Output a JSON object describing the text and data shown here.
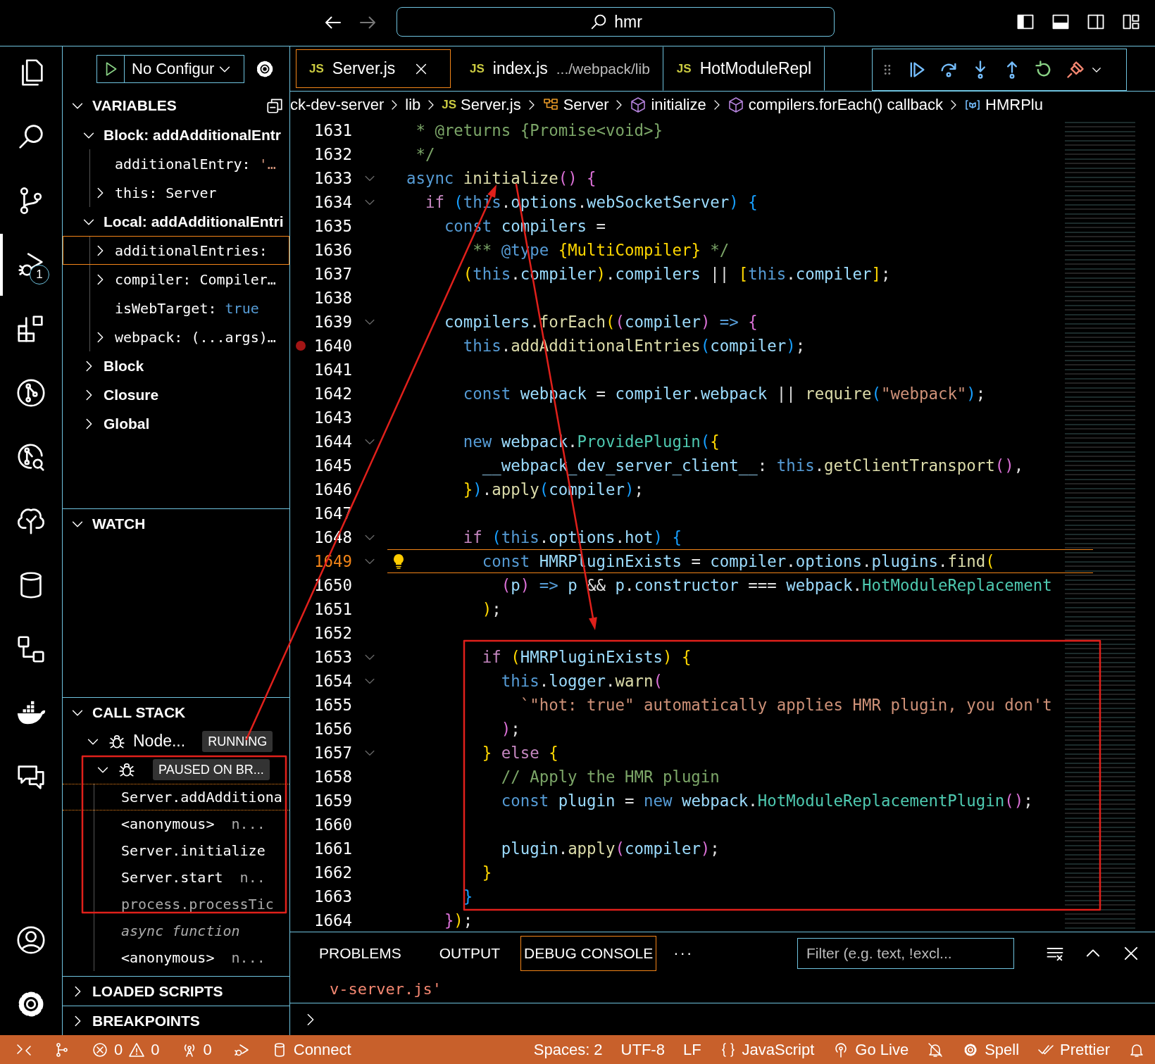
{
  "title_bar": {
    "command_center": {
      "text": "hmr"
    }
  },
  "activity_bar": {
    "items": [
      {
        "kind": "files",
        "selected": false
      },
      {
        "kind": "search",
        "selected": false
      },
      {
        "kind": "source-control",
        "selected": false
      },
      {
        "kind": "run-debug",
        "selected": true,
        "badge": "1"
      },
      {
        "kind": "extensions",
        "selected": false
      },
      {
        "kind": "git-graph",
        "selected": false
      },
      {
        "kind": "git-search",
        "selected": false
      },
      {
        "kind": "tree-check",
        "selected": false
      },
      {
        "kind": "database",
        "selected": false
      },
      {
        "kind": "diagram",
        "selected": false
      },
      {
        "kind": "docker",
        "selected": false
      },
      {
        "kind": "comments",
        "selected": false
      }
    ],
    "bottom_items": [
      {
        "kind": "account",
        "selected": false
      },
      {
        "kind": "settings",
        "selected": false
      }
    ]
  },
  "sidebar": {
    "run_config": "No Configur",
    "variables": {
      "title": "VARIABLES",
      "expanded": true,
      "scopes": [
        {
          "label": "Block: addAdditionalEntr",
          "expanded": true,
          "items": [
            {
              "name": "additionalEntry:",
              "value": "'…",
              "kind": "string",
              "expandable": false,
              "selected": false
            },
            {
              "name": "this:",
              "value": "Server",
              "kind": "object",
              "expandable": true,
              "selected": false
            }
          ]
        },
        {
          "label": "Local: addAdditionalEntri",
          "expanded": true,
          "items": [
            {
              "name": "additionalEntries:",
              "expandable": true,
              "selected": true
            },
            {
              "name": "compiler:",
              "value": "Compiler…",
              "kind": "object",
              "expandable": true,
              "selected": false
            },
            {
              "name": "isWebTarget:",
              "value": "true",
              "kind": "boolean",
              "expandable": false,
              "selected": false
            },
            {
              "name": "webpack:",
              "value": "(...args)…",
              "kind": "object",
              "expandable": true,
              "selected": false
            }
          ]
        },
        {
          "label": "Block",
          "expanded": false
        },
        {
          "label": "Closure",
          "expanded": false
        },
        {
          "label": "Global",
          "expanded": false
        }
      ]
    },
    "watch": {
      "title": "WATCH",
      "expanded": true
    },
    "call_stack": {
      "title": "CALL STACK",
      "expanded": true,
      "threads": [
        {
          "name": "Node...",
          "status": "RUNNING",
          "expanded": true
        },
        {
          "status": "PAUSED ON BR...",
          "expanded": true
        }
      ],
      "frames": [
        {
          "kind": "frame",
          "name": "Server.addAdditiona",
          "selected": true,
          "dimmed": false
        },
        {
          "kind": "frame",
          "name": "<anonymous>",
          "source": "n...",
          "selected": false,
          "dimmed": false
        },
        {
          "kind": "frame",
          "name": "Server.initialize",
          "selected": false,
          "dimmed": false
        },
        {
          "kind": "frame",
          "name": "Server.start",
          "source": "n..",
          "selected": false,
          "dimmed": false
        },
        {
          "kind": "frame",
          "name": "process.processTic",
          "selected": false,
          "dimmed": true
        },
        {
          "kind": "separator",
          "name": "async function",
          "selected": false,
          "dimmed": true
        },
        {
          "kind": "frame",
          "name": "<anonymous>",
          "source": "n...",
          "selected": false,
          "dimmed": false
        }
      ]
    },
    "loaded_scripts": {
      "title": "LOADED SCRIPTS",
      "expanded": false
    },
    "breakpoints": {
      "title": "BREAKPOINTS",
      "expanded": false
    }
  },
  "editor": {
    "tabs": [
      {
        "badge": "JS",
        "name": "Server.js",
        "selected": true
      },
      {
        "badge": "JS",
        "name": "index.js",
        "description": ".../webpack/lib",
        "selected": false
      },
      {
        "badge": "JS",
        "name": "HotModuleRepl",
        "selected": false
      }
    ],
    "breadcrumbs": [
      {
        "kind": "folder",
        "text": "ck-dev-server"
      },
      {
        "kind": "folder",
        "text": "lib"
      },
      {
        "kind": "file",
        "badge": "JS",
        "text": "Server.js"
      },
      {
        "kind": "class",
        "text": "Server"
      },
      {
        "kind": "method",
        "text": "initialize"
      },
      {
        "kind": "method",
        "text": "compilers.forEach() callback"
      },
      {
        "kind": "variable",
        "text": "HMRPlu"
      }
    ],
    "code_lines": [
      {
        "number": "1631",
        "breakpoint": false,
        "foldable": false,
        "current": false,
        "tokens": [
          {
            "text": "   * @returns {Promise<void>}",
            "kind": "comment"
          }
        ]
      },
      {
        "number": "1632",
        "breakpoint": false,
        "foldable": false,
        "current": false,
        "tokens": [
          {
            "text": "   */",
            "kind": "comment"
          }
        ]
      },
      {
        "number": "1633",
        "breakpoint": false,
        "foldable": true,
        "current": false,
        "tokens": [
          {
            "text": "  async ",
            "kind": "keyword"
          },
          {
            "text": "initialize",
            "kind": "function"
          },
          {
            "text": "() ",
            "kind": "bracket2"
          },
          {
            "text": "{",
            "kind": "bracket2"
          }
        ]
      },
      {
        "number": "1634",
        "breakpoint": false,
        "foldable": true,
        "current": false,
        "tokens": [
          {
            "text": "    if ",
            "kind": "control"
          },
          {
            "text": "(",
            "kind": "bracket3"
          },
          {
            "text": "this",
            "kind": "keyword"
          },
          {
            "text": ".",
            "kind": "punct"
          },
          {
            "text": "options",
            "kind": "variable"
          },
          {
            "text": ".",
            "kind": "punct"
          },
          {
            "text": "webSocketServer",
            "kind": "variable"
          },
          {
            "text": ") ",
            "kind": "bracket3"
          },
          {
            "text": "{",
            "kind": "bracket3"
          }
        ]
      },
      {
        "number": "1635",
        "breakpoint": false,
        "foldable": false,
        "current": false,
        "tokens": [
          {
            "text": "      const ",
            "kind": "keyword"
          },
          {
            "text": "compilers",
            "kind": "variable"
          },
          {
            "text": " =",
            "kind": "punct"
          }
        ]
      },
      {
        "number": "1636",
        "breakpoint": false,
        "foldable": false,
        "current": false,
        "tokens": [
          {
            "text": "         ** ",
            "kind": "comment"
          },
          {
            "text": "@type ",
            "kind": "keyword"
          },
          {
            "text": "{MultiCompiler}",
            "kind": "bracket1"
          },
          {
            "text": " */",
            "kind": "comment"
          }
        ]
      },
      {
        "number": "1637",
        "breakpoint": false,
        "foldable": false,
        "current": false,
        "tokens": [
          {
            "text": "        (",
            "kind": "bracket1"
          },
          {
            "text": "this",
            "kind": "keyword"
          },
          {
            "text": ".",
            "kind": "punct"
          },
          {
            "text": "compiler",
            "kind": "variable"
          },
          {
            "text": ")",
            "kind": "bracket1"
          },
          {
            "text": ".",
            "kind": "punct"
          },
          {
            "text": "compilers",
            "kind": "variable"
          },
          {
            "text": " || ",
            "kind": "punct"
          },
          {
            "text": "[",
            "kind": "bracket1"
          },
          {
            "text": "this",
            "kind": "keyword"
          },
          {
            "text": ".",
            "kind": "punct"
          },
          {
            "text": "compiler",
            "kind": "variable"
          },
          {
            "text": "]",
            "kind": "bracket1"
          },
          {
            "text": ";",
            "kind": "punct"
          }
        ]
      },
      {
        "number": "1638",
        "breakpoint": false,
        "foldable": false,
        "current": false
      },
      {
        "number": "1639",
        "breakpoint": false,
        "foldable": true,
        "current": false,
        "tokens": [
          {
            "text": "      compilers",
            "kind": "variable"
          },
          {
            "text": ".",
            "kind": "punct"
          },
          {
            "text": "forEach",
            "kind": "function"
          },
          {
            "text": "(",
            "kind": "bracket1"
          },
          {
            "text": "(",
            "kind": "bracket2"
          },
          {
            "text": "compiler",
            "kind": "variable"
          },
          {
            "text": ")",
            "kind": "bracket2"
          },
          {
            "text": " => ",
            "kind": "keyword"
          },
          {
            "text": "{",
            "kind": "bracket2"
          }
        ]
      },
      {
        "number": "1640",
        "breakpoint": true,
        "foldable": false,
        "current": false,
        "tokens": [
          {
            "text": "        this",
            "kind": "keyword"
          },
          {
            "text": ".",
            "kind": "punct"
          },
          {
            "text": "addAdditionalEntries",
            "kind": "function"
          },
          {
            "text": "(",
            "kind": "bracket3"
          },
          {
            "text": "compiler",
            "kind": "variable"
          },
          {
            "text": ")",
            "kind": "bracket3"
          },
          {
            "text": ";",
            "kind": "punct"
          }
        ]
      },
      {
        "number": "1641",
        "breakpoint": false,
        "foldable": false,
        "current": false
      },
      {
        "number": "1642",
        "breakpoint": false,
        "foldable": false,
        "current": false,
        "tokens": [
          {
            "text": "        const ",
            "kind": "keyword"
          },
          {
            "text": "webpack",
            "kind": "variable"
          },
          {
            "text": " = ",
            "kind": "punct"
          },
          {
            "text": "compiler",
            "kind": "variable"
          },
          {
            "text": ".",
            "kind": "punct"
          },
          {
            "text": "webpack",
            "kind": "variable"
          },
          {
            "text": " || ",
            "kind": "punct"
          },
          {
            "text": "require",
            "kind": "function"
          },
          {
            "text": "(",
            "kind": "bracket3"
          },
          {
            "text": "\"webpack\"",
            "kind": "string"
          },
          {
            "text": ")",
            "kind": "bracket3"
          },
          {
            "text": ";",
            "kind": "punct"
          }
        ]
      },
      {
        "number": "1643",
        "breakpoint": false,
        "foldable": false,
        "current": false
      },
      {
        "number": "1644",
        "breakpoint": false,
        "foldable": true,
        "current": false,
        "tokens": [
          {
            "text": "        new ",
            "kind": "keyword"
          },
          {
            "text": "webpack",
            "kind": "variable"
          },
          {
            "text": ".",
            "kind": "punct"
          },
          {
            "text": "ProvidePlugin",
            "kind": "class"
          },
          {
            "text": "(",
            "kind": "bracket3"
          },
          {
            "text": "{",
            "kind": "bracket1"
          }
        ]
      },
      {
        "number": "1645",
        "breakpoint": false,
        "foldable": false,
        "current": false,
        "tokens": [
          {
            "text": "          __webpack_dev_server_client__",
            "kind": "variable"
          },
          {
            "text": ": ",
            "kind": "punct"
          },
          {
            "text": "this",
            "kind": "keyword"
          },
          {
            "text": ".",
            "kind": "punct"
          },
          {
            "text": "getClientTransport",
            "kind": "function"
          },
          {
            "text": "()",
            "kind": "bracket2"
          },
          {
            "text": ",",
            "kind": "punct"
          }
        ]
      },
      {
        "number": "1646",
        "breakpoint": false,
        "foldable": false,
        "current": false,
        "tokens": [
          {
            "text": "        }",
            "kind": "bracket1"
          },
          {
            "text": ")",
            "kind": "bracket3"
          },
          {
            "text": ".",
            "kind": "punct"
          },
          {
            "text": "apply",
            "kind": "function"
          },
          {
            "text": "(",
            "kind": "bracket3"
          },
          {
            "text": "compiler",
            "kind": "variable"
          },
          {
            "text": ")",
            "kind": "bracket3"
          },
          {
            "text": ";",
            "kind": "punct"
          }
        ]
      },
      {
        "number": "1647",
        "breakpoint": false,
        "foldable": false,
        "current": false
      },
      {
        "number": "1648",
        "breakpoint": false,
        "foldable": true,
        "current": false,
        "tokens": [
          {
            "text": "        if ",
            "kind": "control"
          },
          {
            "text": "(",
            "kind": "bracket3"
          },
          {
            "text": "this",
            "kind": "keyword"
          },
          {
            "text": ".",
            "kind": "punct"
          },
          {
            "text": "options",
            "kind": "variable"
          },
          {
            "text": ".",
            "kind": "punct"
          },
          {
            "text": "hot",
            "kind": "variable"
          },
          {
            "text": ") ",
            "kind": "bracket3"
          },
          {
            "text": "{",
            "kind": "bracket3"
          }
        ]
      },
      {
        "number": "1649",
        "breakpoint": false,
        "foldable": true,
        "current": true,
        "tokens": [
          {
            "text": "          const ",
            "kind": "keyword"
          },
          {
            "text": "HMRPluginExists",
            "kind": "variable"
          },
          {
            "text": " = ",
            "kind": "punct"
          },
          {
            "text": "compiler",
            "kind": "variable"
          },
          {
            "text": ".",
            "kind": "punct"
          },
          {
            "text": "options",
            "kind": "variable"
          },
          {
            "text": ".",
            "kind": "punct"
          },
          {
            "text": "plugins",
            "kind": "variable"
          },
          {
            "text": ".",
            "kind": "punct"
          },
          {
            "text": "find",
            "kind": "function"
          },
          {
            "text": "(",
            "kind": "bracket1"
          }
        ]
      },
      {
        "number": "1650",
        "breakpoint": false,
        "foldable": false,
        "current": false,
        "tokens": [
          {
            "text": "            (",
            "kind": "bracket2"
          },
          {
            "text": "p",
            "kind": "variable"
          },
          {
            "text": ")",
            "kind": "bracket2"
          },
          {
            "text": " => ",
            "kind": "keyword"
          },
          {
            "text": "p",
            "kind": "variable"
          },
          {
            "text": " && ",
            "kind": "punct"
          },
          {
            "text": "p",
            "kind": "variable"
          },
          {
            "text": ".",
            "kind": "punct"
          },
          {
            "text": "constructor",
            "kind": "variable"
          },
          {
            "text": " === ",
            "kind": "punct"
          },
          {
            "text": "webpack",
            "kind": "variable"
          },
          {
            "text": ".",
            "kind": "punct"
          },
          {
            "text": "HotModuleReplacement",
            "kind": "class"
          }
        ]
      },
      {
        "number": "1651",
        "breakpoint": false,
        "foldable": false,
        "current": false,
        "tokens": [
          {
            "text": "          )",
            "kind": "bracket1"
          },
          {
            "text": ";",
            "kind": "punct"
          }
        ]
      },
      {
        "number": "1652",
        "breakpoint": false,
        "foldable": false,
        "current": false
      },
      {
        "number": "1653",
        "breakpoint": false,
        "foldable": true,
        "current": false,
        "tokens": [
          {
            "text": "          if ",
            "kind": "control"
          },
          {
            "text": "(",
            "kind": "bracket1"
          },
          {
            "text": "HMRPluginExists",
            "kind": "variable"
          },
          {
            "text": ") ",
            "kind": "bracket1"
          },
          {
            "text": "{",
            "kind": "bracket1"
          }
        ]
      },
      {
        "number": "1654",
        "breakpoint": false,
        "foldable": true,
        "current": false,
        "tokens": [
          {
            "text": "            this",
            "kind": "keyword"
          },
          {
            "text": ".",
            "kind": "punct"
          },
          {
            "text": "logger",
            "kind": "variable"
          },
          {
            "text": ".",
            "kind": "punct"
          },
          {
            "text": "warn",
            "kind": "function"
          },
          {
            "text": "(",
            "kind": "bracket2"
          }
        ]
      },
      {
        "number": "1655",
        "breakpoint": false,
        "foldable": false,
        "current": false,
        "tokens": [
          {
            "text": "              `\"hot: true\" automatically applies HMR plugin, you don't",
            "kind": "string"
          }
        ]
      },
      {
        "number": "1656",
        "breakpoint": false,
        "foldable": false,
        "current": false,
        "tokens": [
          {
            "text": "            )",
            "kind": "bracket2"
          },
          {
            "text": ";",
            "kind": "punct"
          }
        ]
      },
      {
        "number": "1657",
        "breakpoint": false,
        "foldable": true,
        "current": false,
        "tokens": [
          {
            "text": "          } ",
            "kind": "bracket1"
          },
          {
            "text": "else ",
            "kind": "control"
          },
          {
            "text": "{",
            "kind": "bracket1"
          }
        ]
      },
      {
        "number": "1658",
        "breakpoint": false,
        "foldable": false,
        "current": false,
        "tokens": [
          {
            "text": "            // Apply the HMR plugin",
            "kind": "comment"
          }
        ]
      },
      {
        "number": "1659",
        "breakpoint": false,
        "foldable": false,
        "current": false,
        "tokens": [
          {
            "text": "            const ",
            "kind": "keyword"
          },
          {
            "text": "plugin",
            "kind": "variable"
          },
          {
            "text": " = ",
            "kind": "punct"
          },
          {
            "text": "new ",
            "kind": "keyword"
          },
          {
            "text": "webpack",
            "kind": "variable"
          },
          {
            "text": ".",
            "kind": "punct"
          },
          {
            "text": "HotModuleReplacementPlugin",
            "kind": "class"
          },
          {
            "text": "()",
            "kind": "bracket2"
          },
          {
            "text": ";",
            "kind": "punct"
          }
        ]
      },
      {
        "number": "1660",
        "breakpoint": false,
        "foldable": false,
        "current": false
      },
      {
        "number": "1661",
        "breakpoint": false,
        "foldable": false,
        "current": false,
        "tokens": [
          {
            "text": "            plugin",
            "kind": "variable"
          },
          {
            "text": ".",
            "kind": "punct"
          },
          {
            "text": "apply",
            "kind": "function"
          },
          {
            "text": "(",
            "kind": "bracket2"
          },
          {
            "text": "compiler",
            "kind": "variable"
          },
          {
            "text": ")",
            "kind": "bracket2"
          },
          {
            "text": ";",
            "kind": "punct"
          }
        ]
      },
      {
        "number": "1662",
        "breakpoint": false,
        "foldable": false,
        "current": false,
        "tokens": [
          {
            "text": "          }",
            "kind": "bracket1"
          }
        ]
      },
      {
        "number": "1663",
        "breakpoint": false,
        "foldable": false,
        "current": false,
        "tokens": [
          {
            "text": "        }",
            "kind": "bracket3"
          }
        ]
      },
      {
        "number": "1664",
        "breakpoint": false,
        "foldable": false,
        "current": false,
        "tokens": [
          {
            "text": "      }",
            "kind": "bracket2"
          },
          {
            "text": ")",
            "kind": "bracket1"
          },
          {
            "text": ";",
            "kind": "punct"
          }
        ]
      }
    ]
  },
  "panel": {
    "tabs": [
      {
        "label": "PROBLEMS",
        "selected": false
      },
      {
        "label": "OUTPUT",
        "selected": false
      },
      {
        "label": "DEBUG CONSOLE",
        "selected": true
      }
    ],
    "more": "···",
    "filter": {
      "placeholder": "Filter (e.g. text, !excl..."
    },
    "output_lines": [
      "v-server.js'"
    ]
  },
  "status_bar": {
    "left": [
      {
        "kind": "remote"
      },
      {
        "kind": "branch"
      },
      {
        "kind": "problems",
        "errors": "0",
        "warnings": "0"
      },
      {
        "kind": "ports",
        "text": "0"
      },
      {
        "kind": "debug"
      },
      {
        "kind": "database",
        "text": "Connect"
      }
    ],
    "right": [
      {
        "kind": "text",
        "text": "Spaces: 2"
      },
      {
        "kind": "text",
        "text": "UTF-8"
      },
      {
        "kind": "text",
        "text": "LF"
      },
      {
        "kind": "language",
        "text": "JavaScript"
      },
      {
        "kind": "live",
        "text": "Go Live"
      },
      {
        "kind": "muted"
      },
      {
        "kind": "spell",
        "text": "Spell"
      },
      {
        "kind": "prettier",
        "text": "Prettier"
      },
      {
        "kind": "bell"
      }
    ]
  }
}
